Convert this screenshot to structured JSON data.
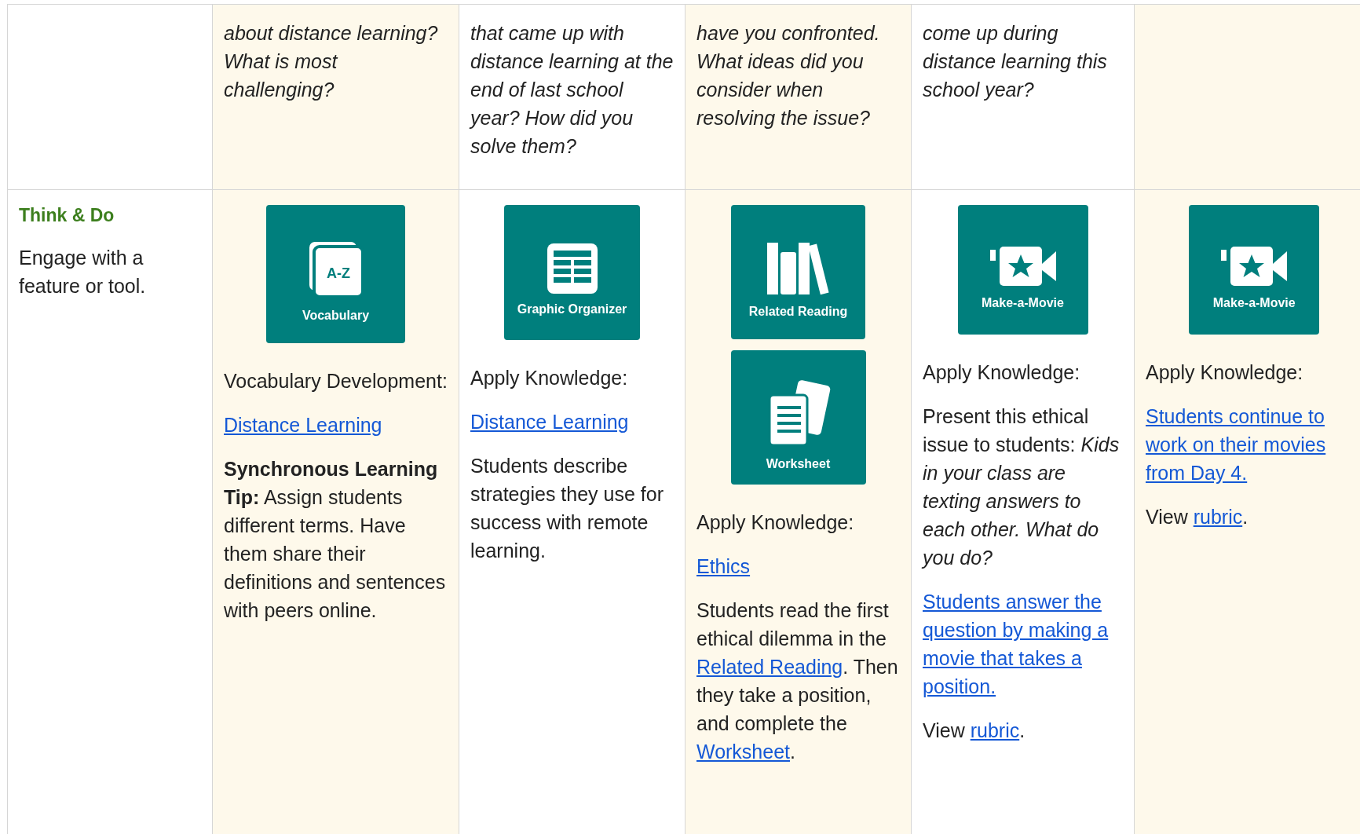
{
  "header_row": {
    "cells": [
      {},
      {
        "text": "about distance learning? What is most challenging?"
      },
      {
        "text": "that came up with distance learning at the end of last school year? How did you solve them?"
      },
      {
        "text": "have you confronted. What ideas did you consider when resolving the issue?"
      },
      {
        "text": "come up during distance learning this school year?"
      },
      {}
    ]
  },
  "row": {
    "label": {
      "title": "Think & Do",
      "description": "Engage with a feature or tool."
    },
    "cells": [
      {
        "tiles": [
          {
            "kind": "vocabulary",
            "label": "Vocabulary",
            "icon_text": "A-Z"
          }
        ],
        "paragraphs": [
          {
            "parts": [
              {
                "kind": "text",
                "text": "Vocabulary Development:"
              }
            ]
          },
          {
            "parts": [
              {
                "kind": "link",
                "text": "Distance Learning"
              }
            ]
          },
          {
            "parts": [
              {
                "kind": "bold",
                "text": "Synchronous Learning Tip:"
              },
              {
                "kind": "text",
                "text": " Assign students different terms. Have them share their definitions and sentences with peers online."
              }
            ]
          }
        ]
      },
      {
        "tiles": [
          {
            "kind": "organizer",
            "label": "Graphic Organizer"
          }
        ],
        "paragraphs": [
          {
            "parts": [
              {
                "kind": "text",
                "text": "Apply Knowledge:"
              }
            ]
          },
          {
            "parts": [
              {
                "kind": "link",
                "text": "Distance Learning"
              }
            ]
          },
          {
            "parts": [
              {
                "kind": "text",
                "text": "Students describe strategies they use for success with remote learning."
              }
            ]
          }
        ]
      },
      {
        "tiles": [
          {
            "kind": "reading",
            "label": "Related Reading"
          },
          {
            "kind": "worksheet",
            "label": "Worksheet"
          }
        ],
        "paragraphs": [
          {
            "parts": [
              {
                "kind": "text",
                "text": "Apply Knowledge:"
              }
            ]
          },
          {
            "parts": [
              {
                "kind": "link",
                "text": "Ethics"
              }
            ]
          },
          {
            "parts": [
              {
                "kind": "text",
                "text": "Students read the first ethical dilemma in the "
              },
              {
                "kind": "link",
                "text": "Related Reading"
              },
              {
                "kind": "text",
                "text": ". Then they take a position, and complete the "
              },
              {
                "kind": "link",
                "text": "Worksheet"
              },
              {
                "kind": "text",
                "text": "."
              }
            ]
          }
        ]
      },
      {
        "tiles": [
          {
            "kind": "movie",
            "label": "Make-a-Movie"
          }
        ],
        "paragraphs": [
          {
            "parts": [
              {
                "kind": "text",
                "text": "Apply Knowledge:"
              }
            ]
          },
          {
            "parts": [
              {
                "kind": "text",
                "text": "Present this ethical issue to students: "
              },
              {
                "kind": "italic",
                "text": "Kids in your class are texting answers to each other. What do you do?"
              }
            ]
          },
          {
            "parts": [
              {
                "kind": "link",
                "text": "Students answer the question by making a movie that takes a position."
              }
            ]
          },
          {
            "parts": [
              {
                "kind": "text",
                "text": "View "
              },
              {
                "kind": "link",
                "text": "rubric"
              },
              {
                "kind": "text",
                "text": "."
              }
            ]
          }
        ]
      },
      {
        "tiles": [
          {
            "kind": "movie",
            "label": "Make-a-Movie"
          }
        ],
        "paragraphs": [
          {
            "parts": [
              {
                "kind": "text",
                "text": "Apply Knowledge:"
              }
            ]
          },
          {
            "parts": [
              {
                "kind": "link",
                "text": "Students continue to work on their movies from Day 4."
              }
            ]
          },
          {
            "parts": [
              {
                "kind": "text",
                "text": "View "
              },
              {
                "kind": "link",
                "text": "rubric"
              },
              {
                "kind": "text",
                "text": "."
              }
            ]
          }
        ]
      }
    ]
  }
}
